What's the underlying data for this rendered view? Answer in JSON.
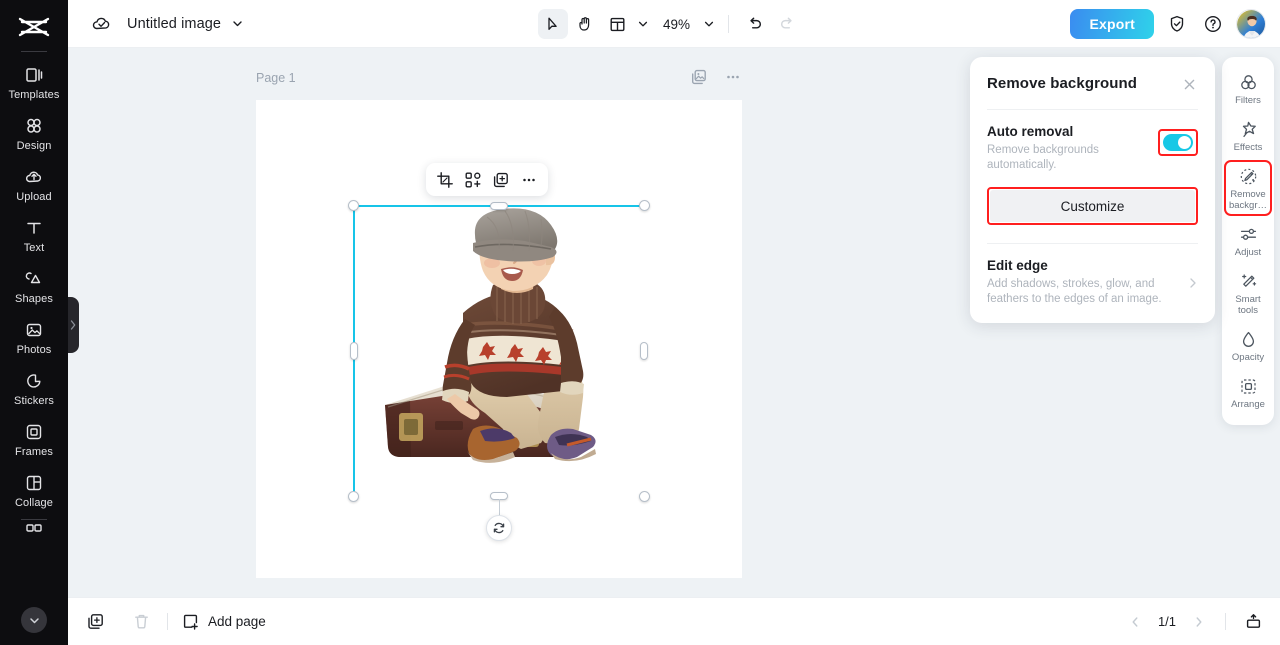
{
  "app": {
    "brand_icon": "capcut-logo-icon",
    "accent_cyan": "#17c8e6",
    "accent_blue": "#3a8cf0",
    "highlight_red": "#ff1f1f"
  },
  "left_rail": {
    "items": [
      {
        "label": "Templates",
        "icon": "templates-icon"
      },
      {
        "label": "Design",
        "icon": "design-icon"
      },
      {
        "label": "Upload",
        "icon": "upload-cloud-icon"
      },
      {
        "label": "Text",
        "icon": "text-icon"
      },
      {
        "label": "Shapes",
        "icon": "shapes-icon"
      },
      {
        "label": "Photos",
        "icon": "photos-icon"
      },
      {
        "label": "Stickers",
        "icon": "stickers-icon"
      },
      {
        "label": "Frames",
        "icon": "frames-icon"
      },
      {
        "label": "Collage",
        "icon": "collage-icon"
      }
    ],
    "collapse_icon": "chevron-down-icon",
    "panel_handle_icon": "chevron-right-icon"
  },
  "topbar": {
    "cloud_icon": "cloud-saved-icon",
    "document_title": "Untitled image",
    "title_caret_icon": "chevron-down-icon",
    "tools": [
      {
        "name": "select-tool",
        "icon": "cursor-arrow-icon",
        "active": true
      },
      {
        "name": "hand-tool",
        "icon": "hand-icon",
        "active": false
      },
      {
        "name": "layout-tool",
        "icon": "layout-grid-icon",
        "active": false
      }
    ],
    "layout_caret_icon": "chevron-down-icon",
    "zoom_level": "49%",
    "zoom_caret_icon": "chevron-down-icon",
    "undo_icon": "undo-icon",
    "redo_icon": "redo-icon",
    "export_label": "Export",
    "shield_icon": "shield-check-icon",
    "help_icon": "question-circle-icon",
    "avatar_icon": "user-avatar"
  },
  "canvas": {
    "page_label": "Page 1",
    "page_tools": [
      {
        "name": "duplicate-page-button",
        "icon": "duplicate-page-icon"
      },
      {
        "name": "page-more-button",
        "icon": "more-horizontal-icon"
      }
    ],
    "element_toolbar": [
      {
        "name": "crop-button",
        "icon": "crop-icon"
      },
      {
        "name": "position-button",
        "icon": "align-position-icon"
      },
      {
        "name": "duplicate-button",
        "icon": "duplicate-layer-icon"
      },
      {
        "name": "more-button",
        "icon": "more-horizontal-icon"
      }
    ],
    "selection": {
      "alt": "Toddler in flat cap sitting on a vintage suitcase",
      "rotate_icon": "rotate-icon",
      "handles": [
        "top-left",
        "top-center",
        "top-right",
        "middle-left",
        "middle-right",
        "bottom-left",
        "bottom-center",
        "bottom-right"
      ]
    }
  },
  "remove_bg_panel": {
    "title": "Remove background",
    "close_icon": "close-icon",
    "auto_removal": {
      "title": "Auto removal",
      "description": "Remove backgrounds automatically.",
      "toggle_on": true,
      "highlighted": true
    },
    "customize_label": "Customize",
    "customize_highlighted": true,
    "edit_edge": {
      "title": "Edit edge",
      "description": "Add shadows, strokes, glow, and feathers to the edges of an image.",
      "chevron_icon": "chevron-right-icon"
    }
  },
  "right_rail": {
    "items": [
      {
        "label": "Filters",
        "icon": "filters-icon",
        "selected": false
      },
      {
        "label": "Effects",
        "icon": "effects-star-icon",
        "selected": false
      },
      {
        "label": "Remove backgr…",
        "icon": "remove-background-icon",
        "selected": true
      },
      {
        "label": "Adjust",
        "icon": "adjust-sliders-icon",
        "selected": false
      },
      {
        "label": "Smart tools",
        "icon": "smart-wand-icon",
        "selected": false
      },
      {
        "label": "Opacity",
        "icon": "opacity-drop-icon",
        "selected": false
      },
      {
        "label": "Arrange",
        "icon": "arrange-icon",
        "selected": false
      }
    ]
  },
  "bottombar": {
    "duplicate_icon": "duplicate-page-icon",
    "delete_icon": "trash-icon",
    "add_page_label": "Add page",
    "add_page_icon": "add-page-icon",
    "prev_icon": "chevron-left-icon",
    "next_icon": "chevron-right-icon",
    "page_indicator": "1/1",
    "present_icon": "present-icon"
  }
}
